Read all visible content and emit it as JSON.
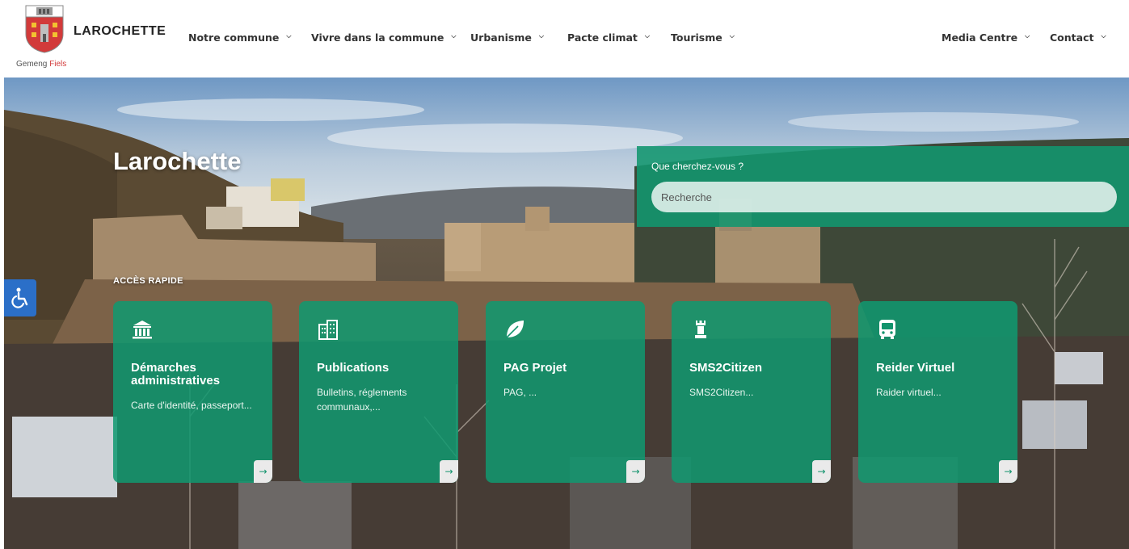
{
  "header": {
    "site_name": "LAROCHETTE",
    "subtitle_prefix": "Gemeng ",
    "subtitle_accent": "Fiels",
    "nav": [
      {
        "label": "Notre commune"
      },
      {
        "label": "Vivre dans la commune"
      },
      {
        "label": "Urbanisme"
      },
      {
        "label": "Pacte climat"
      },
      {
        "label": "Tourisme"
      },
      {
        "label": "Media Centre"
      },
      {
        "label": "Contact"
      }
    ],
    "chevron": "⌄"
  },
  "hero": {
    "title": "Larochette",
    "search": {
      "label": "Que cherchez-vous ?",
      "placeholder": "Recherche"
    },
    "quick_access_label": "ACCÈS RAPIDE",
    "cards": [
      {
        "title": "Démarches administratives",
        "desc": "Carte d'identité, passeport...",
        "icon": "bank-icon"
      },
      {
        "title": "Publications",
        "desc": "Bulletins, réglements communaux,...",
        "icon": "buildings-icon"
      },
      {
        "title": "PAG Projet",
        "desc": "PAG, ...",
        "icon": "leaf-icon"
      },
      {
        "title": "SMS2Citizen",
        "desc": "SMS2Citizen...",
        "icon": "chess-rook-icon"
      },
      {
        "title": "Reider Virtuel",
        "desc": "Raider virtuel...",
        "icon": "bus-icon"
      }
    ],
    "arrow": "→"
  },
  "colors": {
    "accent_green": "#12966e",
    "accessibility_blue": "#2b6fc8",
    "logo_red": "#d23a3a"
  }
}
